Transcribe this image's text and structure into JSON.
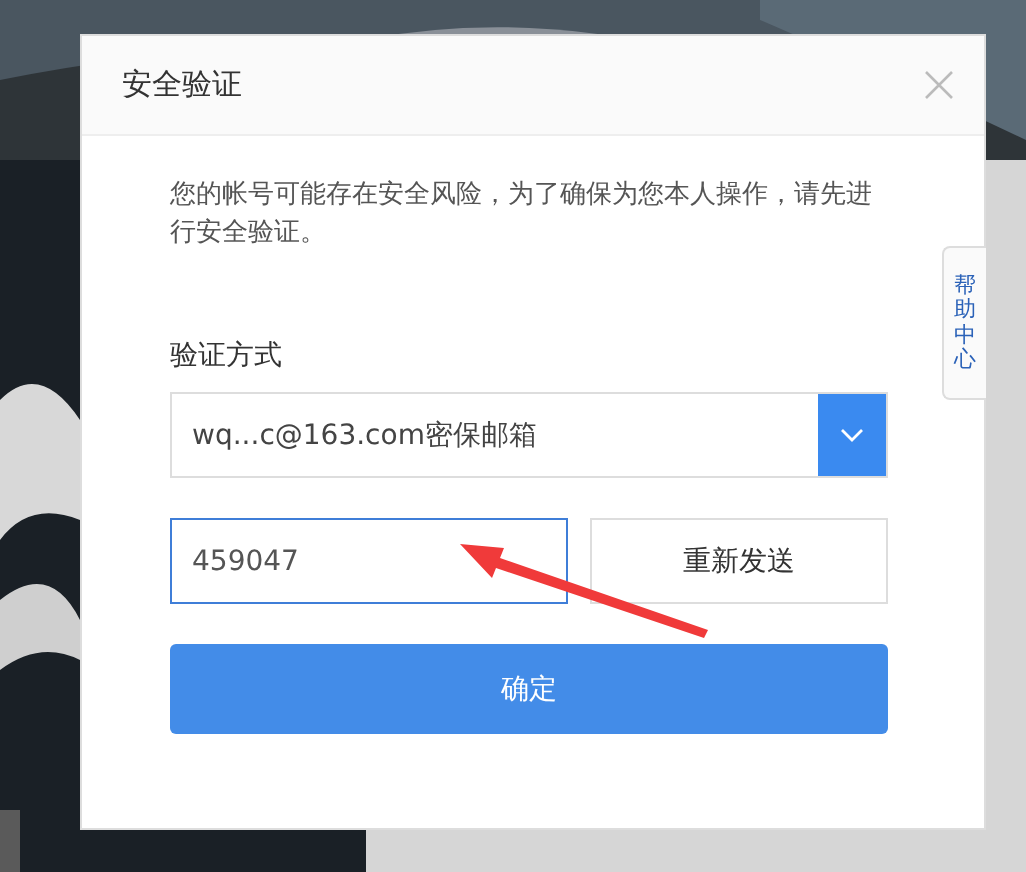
{
  "dialog": {
    "title": "安全验证",
    "message": "您的帐号可能存在安全风险，为了确保为您本人操作，请先进行安全验证。",
    "method": {
      "label": "验证方式",
      "value": "wq...c@163.com密保邮箱"
    },
    "code": {
      "value": "459047"
    },
    "resend_button": "重新发送",
    "confirm_button": "确定"
  },
  "help_tab": "帮助中心"
}
